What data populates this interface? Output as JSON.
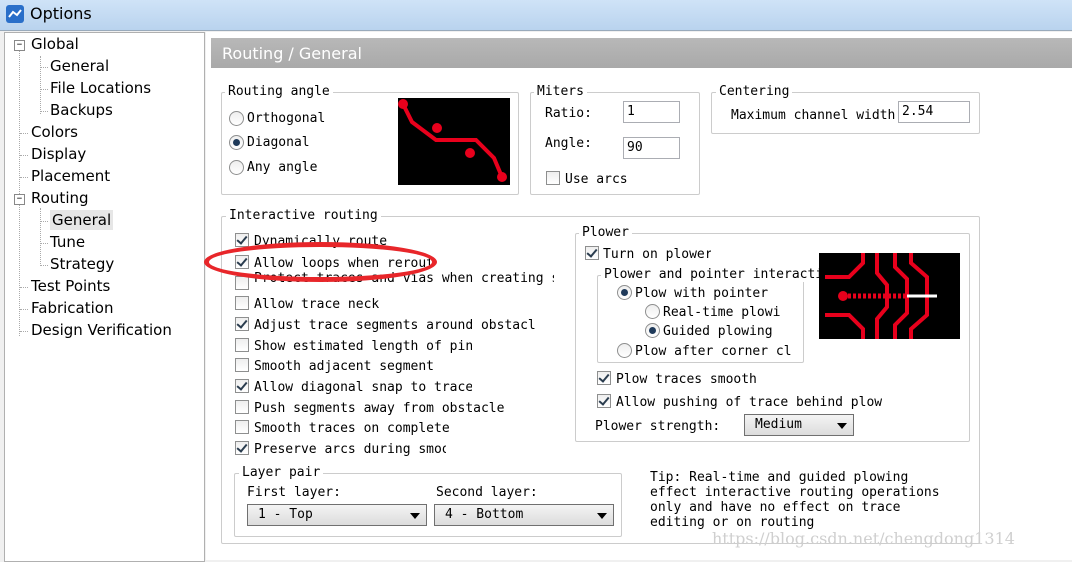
{
  "window": {
    "title": "Options"
  },
  "tree": {
    "items": [
      {
        "label": "Global"
      },
      {
        "label": "General"
      },
      {
        "label": "File Locations"
      },
      {
        "label": "Backups"
      },
      {
        "label": "Colors"
      },
      {
        "label": "Display"
      },
      {
        "label": "Placement"
      },
      {
        "label": "Routing"
      },
      {
        "label": "General"
      },
      {
        "label": "Tune"
      },
      {
        "label": "Strategy"
      },
      {
        "label": "Test Points"
      },
      {
        "label": "Fabrication"
      },
      {
        "label": "Design Verification"
      }
    ],
    "expander_minus": "−"
  },
  "header": {
    "title": "Routing / General"
  },
  "routing_angle": {
    "legend": "Routing angle",
    "options": [
      {
        "label": "Orthogonal"
      },
      {
        "label": "Diagonal"
      },
      {
        "label": "Any angle"
      }
    ],
    "selected": "Diagonal"
  },
  "miters": {
    "legend": "Miters",
    "ratio_label": "Ratio:",
    "ratio_value": "1",
    "angle_label": "Angle:",
    "angle_value": "90",
    "use_arcs_label": "Use arcs"
  },
  "centering": {
    "legend": "Centering",
    "max_width_label": "Maximum channel width",
    "max_width_value": "2.54"
  },
  "interactive": {
    "legend": "Interactive routing",
    "checks": [
      {
        "label": "Dynamically route",
        "checked": true
      },
      {
        "label": "Allow loops when rerouting",
        "checked": true
      },
      {
        "label": "Protect traces and vias when creating segments",
        "checked": false
      },
      {
        "label": "Allow trace neck",
        "checked": false
      },
      {
        "label": "Adjust trace segments around obstacles",
        "checked": true
      },
      {
        "label": "Show estimated length of pin",
        "checked": false
      },
      {
        "label": "Smooth adjacent segment",
        "checked": false
      },
      {
        "label": "Allow diagonal snap to trace",
        "checked": true
      },
      {
        "label": "Push segments away from obstacle",
        "checked": false
      },
      {
        "label": "Smooth traces on complete",
        "checked": false
      },
      {
        "label": "Preserve arcs during smoothing",
        "checked": true
      }
    ]
  },
  "plower": {
    "legend": "Plower",
    "turn_on_label": "Turn on plower",
    "interaction_legend": "Plower and pointer interaction",
    "plow_with_pointer": "Plow with pointer",
    "realtime": "Real-time plowing",
    "guided": "Guided plowing",
    "plow_after": "Plow after corner click",
    "plow_smooth": "Plow traces smoothly",
    "allow_push": "Allow pushing of trace behind plow",
    "strength_label": "Plower strength:",
    "strength_value": "Medium"
  },
  "layer_pair": {
    "legend": "Layer pair",
    "first_label": "First layer:",
    "first_value": "1 - Top",
    "second_label": "Second layer:",
    "second_value": "4 - Bottom"
  },
  "tip": {
    "text": "Tip: Real-time and guided plowing effect interactive routing operations only and have no effect on trace editing or on routing"
  },
  "watermark": "https://blog.csdn.net/chengdong1314",
  "colors": {
    "trace": "#e8001c",
    "annotation": "#e8262a"
  }
}
